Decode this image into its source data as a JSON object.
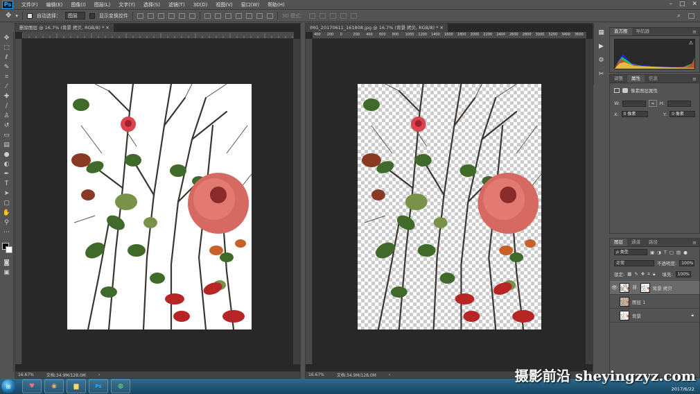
{
  "app": {
    "logo": "Ps"
  },
  "menu": [
    "文件(F)",
    "编辑(E)",
    "图像(I)",
    "图层(L)",
    "文字(Y)",
    "选择(S)",
    "滤镜(T)",
    "3D(D)",
    "视图(V)",
    "窗口(W)",
    "帮助(H)"
  ],
  "options": {
    "auto_select_label": "自动选择：",
    "auto_select_value": "图层",
    "show_transform_label": "显示变换控件",
    "mode_3d_label": "3D 模式："
  },
  "documents": [
    {
      "tab_title": "删除图层 @ 16.7% (背景 拷贝, RGB/8) *",
      "zoom": "16.67%",
      "doc_size": "文档:34.9M/128.0M"
    },
    {
      "tab_title": "IMG_20170611_161808.jpg @ 16.7% (背景 拷贝, RGB/8) *",
      "zoom": "16.67%",
      "doc_size": "文档:34.9M/128.0M",
      "ruler_labels": [
        "400",
        "200",
        "0",
        "200",
        "400",
        "600",
        "800",
        "1000",
        "1200",
        "1400",
        "1600",
        "1800",
        "2000",
        "2200",
        "2400",
        "2600",
        "2800",
        "3000",
        "3200",
        "3400",
        "3600"
      ]
    }
  ],
  "panels": {
    "histogram_tabs": [
      "直方图",
      "导航器"
    ],
    "properties_tabs": [
      "调整",
      "属性",
      "信息"
    ],
    "properties_title": "像素图层属性",
    "w_label": "W:",
    "h_label": "H:",
    "x_label": "X:",
    "x_value": "0 像素",
    "y_label": "Y:",
    "y_value": "0 像素",
    "layers_tabs": [
      "图层",
      "通道",
      "路径"
    ],
    "kind_filter": "ρ 类型",
    "blend_mode": "正常",
    "opacity_label": "不透明度:",
    "opacity_value": "100%",
    "lock_label": "锁定:",
    "fill_label": "填充:",
    "fill_value": "100%",
    "layers": [
      {
        "name": "背景 拷贝",
        "visible": true,
        "selected": true
      },
      {
        "name": "图层 1",
        "visible": false,
        "selected": false
      },
      {
        "name": "背景",
        "visible": false,
        "selected": false,
        "locked": true
      }
    ]
  },
  "taskbar": {
    "date": "2017/6/22"
  },
  "watermark": "摄影前沿 sheyingzyz.com",
  "colors": {
    "accent": "#31a8ff",
    "panel_bg": "#535353",
    "canvas_bg": "#282828"
  }
}
